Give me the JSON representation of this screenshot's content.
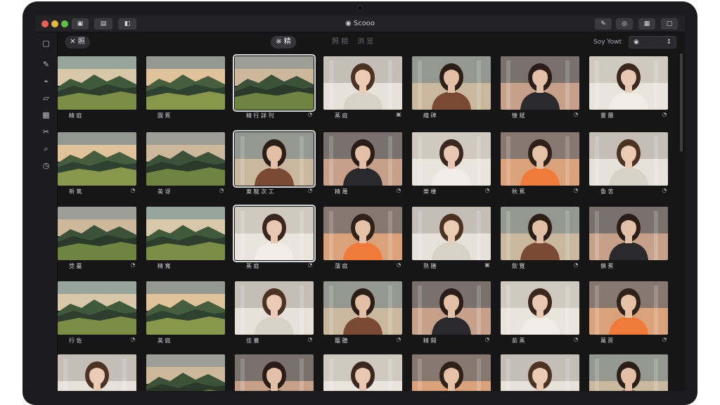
{
  "window": {
    "title": "Scooo",
    "toolbar_buttons_left": [
      "▣",
      "▤",
      "◧"
    ],
    "toolbar_buttons_right": [
      "✎",
      "◎",
      "▦",
      "▢"
    ]
  },
  "sidebar": {
    "icons": [
      "photos-icon",
      "pen-icon",
      "link-icon",
      "folder-icon",
      "grid-icon",
      "scissors-icon",
      "search-icon",
      "clock-icon"
    ],
    "glyphs": [
      "▢",
      "✎",
      "⌁",
      "▱",
      "▦",
      "✂",
      "⌕",
      "◷"
    ]
  },
  "toolbar": {
    "back_label": "✕ 照",
    "tabs": [
      "※ 精",
      "照 相",
      "浏 览"
    ],
    "sort_label": "Soy Yowt",
    "sort_icon": "◉",
    "sort_chevron": "↕"
  },
  "grid": {
    "rows": [
      [
        {
          "type": "landscape",
          "caption": "精 庭",
          "icon": ""
        },
        {
          "type": "landscape",
          "caption": "園 蕉",
          "icon": ""
        },
        {
          "type": "landscape",
          "caption": "精 行 詳 刊",
          "icon": "◔",
          "selected": true
        },
        {
          "type": "portrait",
          "caption": "蒸 庭",
          "icon": "▣"
        },
        {
          "type": "portrait",
          "caption": "織 碑",
          "icon": ""
        },
        {
          "type": "portrait",
          "caption": "懐 斌",
          "icon": "◔"
        },
        {
          "type": "portrait",
          "caption": "靈 蘭",
          "icon": "◔"
        }
      ],
      [
        {
          "type": "landscape",
          "caption": "新 篤",
          "icon": "◔"
        },
        {
          "type": "landscape",
          "caption": "美 讶",
          "icon": "◔"
        },
        {
          "type": "portrait",
          "caption": "東 龍 次 工",
          "icon": "◔",
          "selected": true
        },
        {
          "type": "portrait",
          "caption": "精 蔑",
          "icon": "◔"
        },
        {
          "type": "portrait",
          "caption": "樂 楼",
          "icon": "◔"
        },
        {
          "type": "portrait",
          "caption": "秋 蕉",
          "icon": "◔"
        },
        {
          "type": "portrait",
          "caption": "魯 苦",
          "icon": "◔"
        }
      ],
      [
        {
          "type": "landscape",
          "caption": "茭 蔓",
          "icon": "◔"
        },
        {
          "type": "landscape",
          "caption": "精 寬",
          "icon": ""
        },
        {
          "type": "portrait",
          "caption": "蒸 庭",
          "icon": "◔",
          "selected": true
        },
        {
          "type": "portrait",
          "caption": "蒲 庭",
          "icon": "◔"
        },
        {
          "type": "portrait",
          "caption": "熟 膳",
          "icon": "▣"
        },
        {
          "type": "portrait",
          "caption": "飲 覽",
          "icon": "◔"
        },
        {
          "type": "portrait",
          "caption": "鎖 蕉",
          "icon": ""
        }
      ],
      [
        {
          "type": "landscape",
          "caption": "行 佐",
          "icon": "◔"
        },
        {
          "type": "landscape",
          "caption": "美 庭",
          "icon": ""
        },
        {
          "type": "portrait",
          "caption": "佳 蓋",
          "icon": "◔"
        },
        {
          "type": "portrait",
          "caption": "籠 聽",
          "icon": "◔"
        },
        {
          "type": "portrait",
          "caption": "精 開",
          "icon": "◔"
        },
        {
          "type": "portrait",
          "caption": "茹 蒸",
          "icon": "◔"
        },
        {
          "type": "portrait",
          "caption": "萬 蔗",
          "icon": "◔"
        }
      ],
      [
        {
          "type": "portrait",
          "caption": "",
          "icon": ""
        },
        {
          "type": "landscape",
          "caption": "",
          "icon": ""
        },
        {
          "type": "portrait",
          "caption": "",
          "icon": ""
        },
        {
          "type": "portrait",
          "caption": "",
          "icon": ""
        },
        {
          "type": "portrait",
          "caption": "",
          "icon": ""
        },
        {
          "type": "portrait",
          "caption": "",
          "icon": ""
        },
        {
          "type": "portrait",
          "caption": "",
          "icon": ""
        }
      ]
    ]
  },
  "colors": {
    "background": "#161617",
    "titlebar": "#232325",
    "accent_selected": "#d6d6d6"
  }
}
